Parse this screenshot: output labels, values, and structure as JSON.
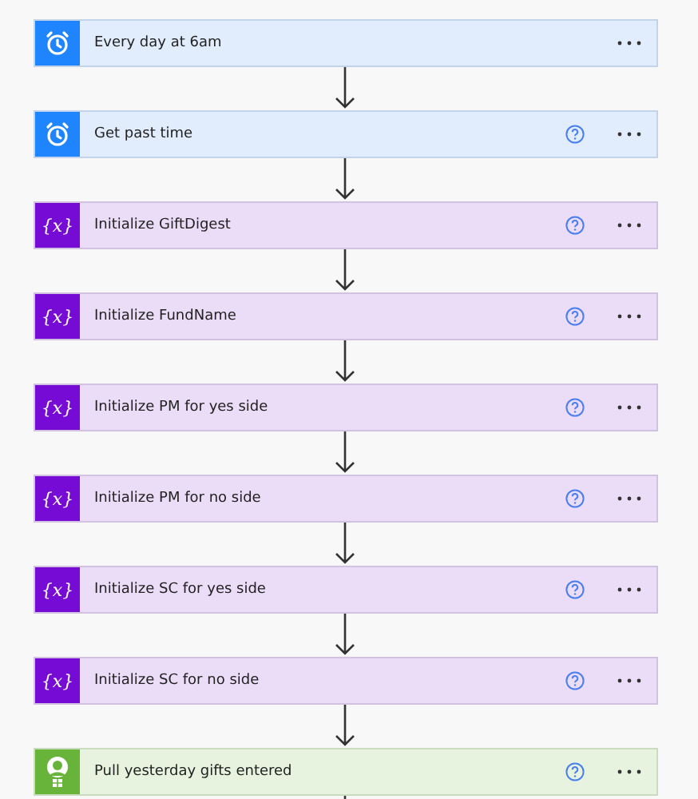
{
  "steps": [
    {
      "kind": "schedule",
      "title": "Every day at 6am",
      "help": false
    },
    {
      "kind": "schedule",
      "title": "Get past time",
      "help": true
    },
    {
      "kind": "variable",
      "icon_glyph": "{x}",
      "title": "Initialize GiftDigest",
      "help": true
    },
    {
      "kind": "variable",
      "icon_glyph": "{x}",
      "title": "Initialize FundName",
      "help": true
    },
    {
      "kind": "variable",
      "icon_glyph": "{x}",
      "title": "Initialize PM for yes side",
      "help": true
    },
    {
      "kind": "variable",
      "icon_glyph": "{x}",
      "title": "Initialize PM for no side",
      "help": true
    },
    {
      "kind": "variable",
      "icon_glyph": "{x}",
      "title": "Initialize SC for yes side",
      "help": true
    },
    {
      "kind": "variable",
      "icon_glyph": "{x}",
      "title": "Initialize SC for no side",
      "help": true
    },
    {
      "kind": "connector",
      "title": "Pull yesterday gifts entered",
      "help": true
    }
  ]
}
